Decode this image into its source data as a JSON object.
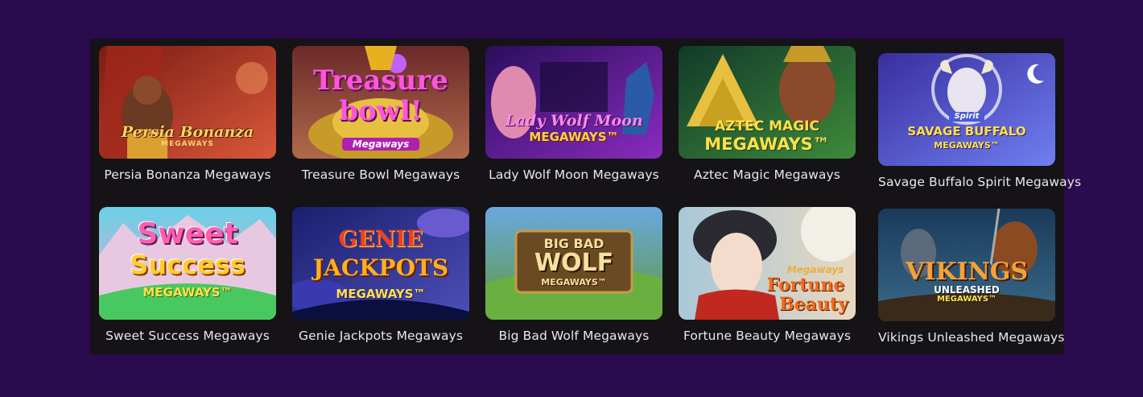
{
  "games": [
    {
      "title": "Persia Bonanza Megaways",
      "logo_lines": [
        "Persia Bonanza",
        "MEGAWAYS"
      ],
      "colors": {
        "bg1": "#7a1c14",
        "bg2": "#d9583a",
        "accent": "#f2c14e"
      }
    },
    {
      "title": "Treasure Bowl Megaways",
      "logo_lines": [
        "Treasure",
        "bowl!",
        "Megaways"
      ],
      "colors": {
        "bg1": "#6b2a2a",
        "bg2": "#b06a4a",
        "accent": "#ff3fd0"
      }
    },
    {
      "title": "Lady Wolf Moon Megaways",
      "logo_lines": [
        "Lady Wolf Moon",
        "MEGAWAYS™"
      ],
      "colors": {
        "bg1": "#2a0e5c",
        "bg2": "#8a2bbf",
        "accent": "#ff66e6"
      }
    },
    {
      "title": "Aztec Magic Megaways",
      "logo_lines": [
        "AZTEC MAGIC",
        "MEGAWAYS™"
      ],
      "colors": {
        "bg1": "#123a2a",
        "bg2": "#3e8a3a",
        "accent": "#f6d23a"
      }
    },
    {
      "title": "Savage Buffalo Spirit Megaways",
      "logo_lines": [
        "Spirit",
        "SAVAGE BUFFALO",
        "MEGAWAYS™"
      ],
      "colors": {
        "bg1": "#3a2ea0",
        "bg2": "#6f7ff0",
        "accent": "#f6d23a"
      }
    },
    {
      "title": "Sweet Success Megaways",
      "logo_lines": [
        "Sweet",
        "Success",
        "MEGAWAYS™"
      ],
      "colors": {
        "bg1": "#6ad0e8",
        "bg2": "#f2a7c8",
        "accent": "#ff4fa0"
      }
    },
    {
      "title": "Genie Jackpots Megaways",
      "logo_lines": [
        "GENIE",
        "JACKPOTS",
        "MEGAWAYS™"
      ],
      "colors": {
        "bg1": "#1a1f6e",
        "bg2": "#4e4fb8",
        "accent": "#f6a12a"
      }
    },
    {
      "title": "Big Bad Wolf Megaways",
      "logo_lines": [
        "BIG BAD",
        "WOLF",
        "MEGAWAYS™"
      ],
      "colors": {
        "bg1": "#6aa8e0",
        "bg2": "#5d9a3a",
        "accent": "#f2d28a"
      }
    },
    {
      "title": "Fortune Beauty Megaways",
      "logo_lines": [
        "Megaways",
        "Fortune",
        "Beauty"
      ],
      "colors": {
        "bg1": "#a8c8d8",
        "bg2": "#e8d8c0",
        "accent": "#e05a1a"
      }
    },
    {
      "title": "Vikings Unleashed Megaways",
      "logo_lines": [
        "VIKINGS",
        "UNLEASHED",
        "MEGAWAYS™"
      ],
      "colors": {
        "bg1": "#1a3a5a",
        "bg2": "#3a6a8a",
        "accent": "#f2a23a"
      }
    }
  ]
}
